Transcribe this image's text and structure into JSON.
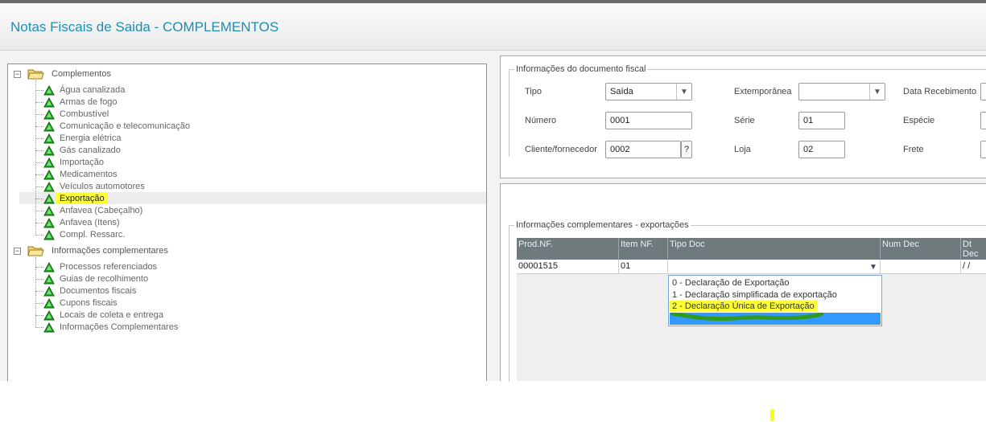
{
  "header": {
    "title": "Notas Fiscais de Saida - COMPLEMENTOS"
  },
  "tree": {
    "group1": {
      "label": "Complementos",
      "items": [
        "Água canalizada",
        "Armas de fogo",
        "Combustível",
        "Comunicação e telecomunicação",
        "Energia elétrica",
        "Gás canalizado",
        "Importação",
        "Medicamentos",
        "Veículos automotores",
        "Exportação",
        "Anfavea (Cabeçalho)",
        "Anfavea (Itens)",
        "Compl. Ressarc."
      ],
      "selected": "Exportação"
    },
    "group2": {
      "label": "Informações complementares",
      "items": [
        "Processos referenciados",
        "Guias de recolhimento",
        "Documentos fiscais",
        "Cupons fiscais",
        "Locais de coleta e entrega",
        "Informações Complementares"
      ]
    }
  },
  "doc": {
    "legend": "Informações do documento fiscal",
    "tipo_label": "Tipo",
    "tipo_value": "Saída",
    "extemporanea_label": "Extemporânea",
    "extemporanea_value": "",
    "data_recebimento_label": "Data Recebimento",
    "numero_label": "Número",
    "numero_value": "0001",
    "serie_label": "Série",
    "serie_value": "01",
    "especie_label": "Espécie",
    "cliente_label": "Cliente/fornecedor",
    "cliente_value": "0002",
    "lookup_label": "?",
    "loja_label": "Loja",
    "loja_value": "02",
    "frete_label": "Frete"
  },
  "exports": {
    "legend": "Informações complementares - exportações",
    "columns": [
      "Prod.NF.",
      "Item NF.",
      "Tipo Doc",
      "Num Dec",
      "Dt Dec"
    ],
    "row": {
      "prod_nf": "00001515",
      "item_nf": "01",
      "tipo_doc": "",
      "num_dec": "",
      "dt_dec": " / /"
    },
    "dropdown_options": [
      "0 - Declaração de Exportação",
      "1 - Declaração simplificada de exportação",
      "2 - Declaração Única de Exportação"
    ],
    "highlighted_option": "2 - Declaração Única de Exportação"
  },
  "colors": {
    "title": "#1a8fb5",
    "grid_header": "#6f7a7c",
    "highlight": "#ffff33",
    "selection": "#3399ff",
    "tree_icon": "#1fa81f"
  }
}
